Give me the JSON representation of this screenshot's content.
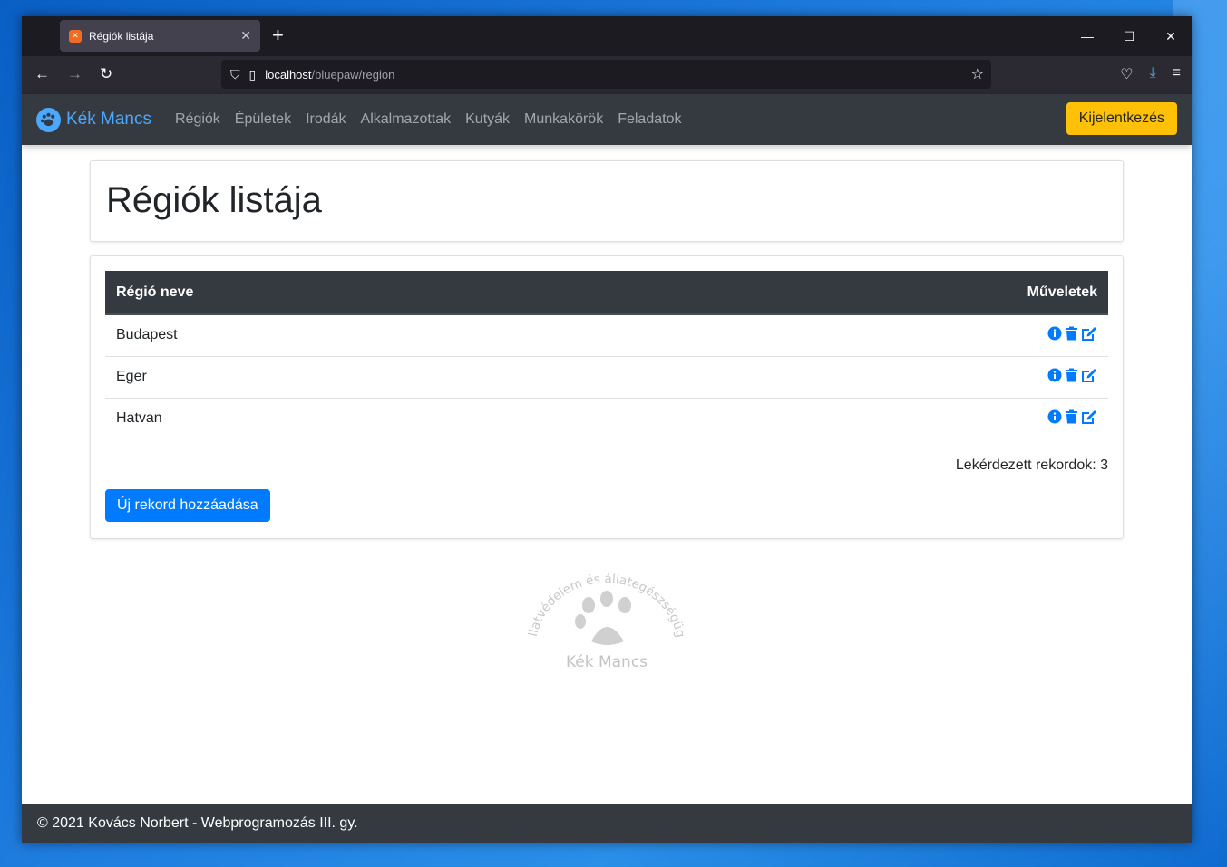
{
  "browser": {
    "tab_title": "Régiók listája",
    "tab_favicon": "xampp-icon",
    "url_host": "localhost",
    "url_path": "/bluepaw/region"
  },
  "site": {
    "brand": "Kék Mancs",
    "nav": [
      "Régiók",
      "Épületek",
      "Irodák",
      "Alkalmazottak",
      "Kutyák",
      "Munkakörök",
      "Feladatok"
    ],
    "logout": "Kijelentkezés"
  },
  "page_title": "Régiók listája",
  "table": {
    "headers": {
      "name": "Régió neve",
      "ops": "Műveletek"
    },
    "rows": [
      {
        "name": "Budapest"
      },
      {
        "name": "Eger"
      },
      {
        "name": "Hatvan"
      }
    ]
  },
  "record_count": "Lekérdezett rekordok: 3",
  "add_button": "Új rekord hozzáadása",
  "watermark": {
    "arc_text": "Állatvédelem és állategészségügy",
    "label": "Kék Mancs"
  },
  "footer": "© 2021 Kovács Norbert - Webprogramozás III. gy.",
  "colors": {
    "primary": "#007bff",
    "warning": "#ffc107",
    "dark": "#343a40",
    "brand": "#4aa8ff"
  }
}
